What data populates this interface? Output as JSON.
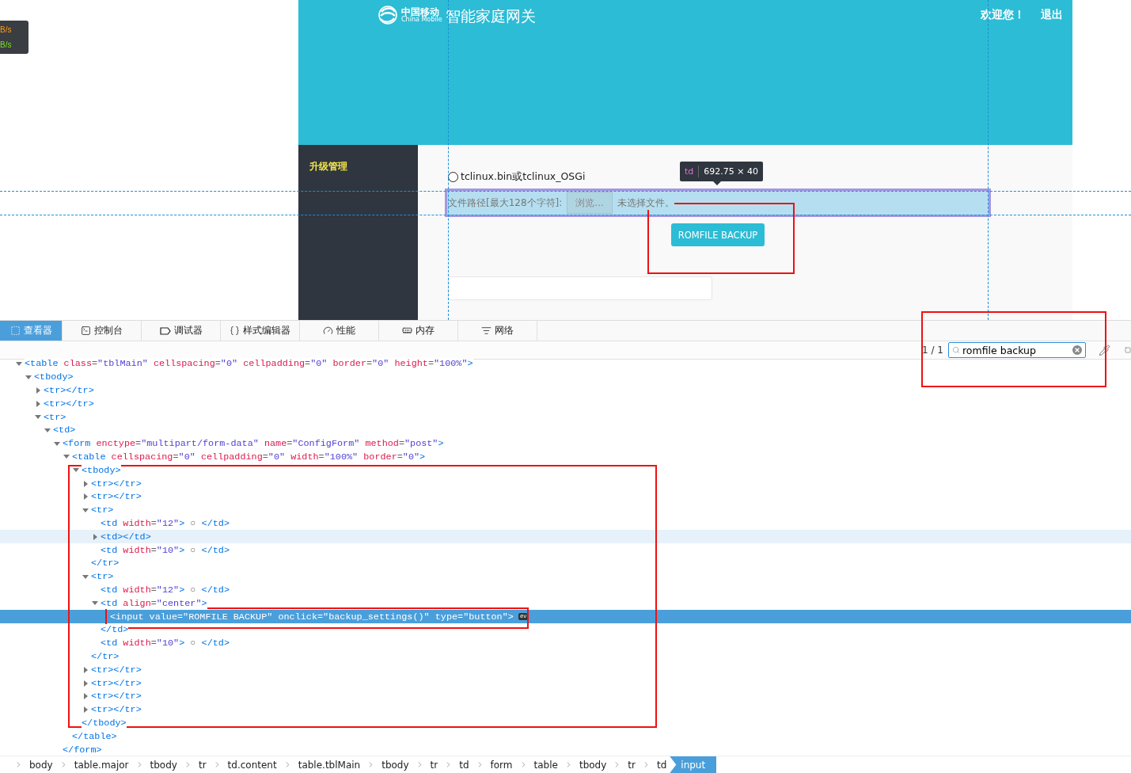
{
  "speed_widget": {
    "lines": [
      {
        "text": "B/s",
        "color": "#ff9c1a"
      },
      {
        "text": "B/s",
        "color": "#7ae01e"
      }
    ]
  },
  "header": {
    "logo_cn": "中国移动",
    "logo_en": "China Mobile",
    "title": "智能家庭网关",
    "links": [
      "欢迎您！",
      "退出"
    ]
  },
  "sidebar": {
    "items": [
      {
        "label": "升级管理",
        "selected": true
      }
    ]
  },
  "content": {
    "radio": {
      "label": "tclinux.bin或tclinux_OSGi",
      "checked": false
    },
    "file_row": {
      "label": "文件路径[最大128个字符]:",
      "browse_button": "浏览...",
      "status": "未选择文件。"
    },
    "backup_button": "ROMFILE BACKUP"
  },
  "inspector_tooltip": {
    "tag": "td",
    "size": "692.75 × 40"
  },
  "devtools": {
    "tabs": [
      {
        "label": "查看器",
        "selected": true
      },
      {
        "label": "控制台",
        "selected": false
      },
      {
        "label": "调试器",
        "selected": false
      },
      {
        "label": "样式编辑器",
        "selected": false
      },
      {
        "label": "性能",
        "selected": false
      },
      {
        "label": "内存",
        "selected": false
      },
      {
        "label": "网络",
        "selected": false
      }
    ],
    "search": {
      "count": "1 / 1",
      "value": "romfile backup"
    },
    "tree": [
      {
        "open": "<table class=\"tblMain\" cellspacing=\"0\" cellpadding=\"0\" border=\"0\" height=\"100%\">",
        "expanded": true,
        "selected": false,
        "hovered": false,
        "children": [
          {
            "open": "<tbody>",
            "expanded": true,
            "selected": false,
            "hovered": false,
            "children": [
              {
                "open": "<tr></tr>",
                "expanded": false,
                "selected": false,
                "hovered": false
              },
              {
                "open": "<tr></tr>",
                "expanded": false,
                "selected": false,
                "hovered": false
              },
              {
                "open": "<tr>",
                "expanded": true,
                "selected": false,
                "hovered": false,
                "children": [
                  {
                    "open": "<td>",
                    "expanded": true,
                    "selected": false,
                    "hovered": false,
                    "children": [
                      {
                        "open": "<form enctype=\"multipart/form-data\" name=\"ConfigForm\" method=\"post\">",
                        "close": "</form>",
                        "expanded": true,
                        "selected": false,
                        "hovered": false,
                        "children": [
                          {
                            "open": "<table cellspacing=\"0\" cellpadding=\"0\" width=\"100%\" border=\"0\">",
                            "close": "</table>",
                            "expanded": true,
                            "selected": false,
                            "hovered": false,
                            "children": [
                              {
                                "open": "<tbody>",
                                "close": "</tbody>",
                                "expanded": true,
                                "selected": false,
                                "hovered": false,
                                "children": [
                                  {
                                    "open": "<tr></tr>",
                                    "expanded": false,
                                    "selected": false,
                                    "hovered": false
                                  },
                                  {
                                    "open": "<tr></tr>",
                                    "expanded": false,
                                    "selected": false,
                                    "hovered": false
                                  },
                                  {
                                    "open": "<tr>",
                                    "close": "</tr>",
                                    "expanded": true,
                                    "selected": false,
                                    "hovered": false,
                                    "children": [
                                      {
                                        "open": "<td width=\"12\"> ○ </td>",
                                        "selected": false,
                                        "hovered": false
                                      },
                                      {
                                        "open": "<td></td>",
                                        "expanded": false,
                                        "selected": false,
                                        "hovered": true
                                      },
                                      {
                                        "open": "<td width=\"10\"> ○ </td>",
                                        "selected": false,
                                        "hovered": false
                                      }
                                    ]
                                  },
                                  {
                                    "open": "<tr>",
                                    "close": "</tr>",
                                    "expanded": true,
                                    "selected": false,
                                    "hovered": false,
                                    "children": [
                                      {
                                        "open": "<td width=\"12\"> ○ </td>",
                                        "selected": false,
                                        "hovered": false
                                      },
                                      {
                                        "open": "<td align=\"center\">",
                                        "close": "</td>",
                                        "expanded": true,
                                        "selected": false,
                                        "hovered": false,
                                        "children": [
                                          {
                                            "open": "<input value=\"ROMFILE BACKUP\" onclick=\"backup_settings()\" type=\"button\">",
                                            "badge": "ev",
                                            "selected": true,
                                            "hovered": false
                                          }
                                        ]
                                      },
                                      {
                                        "open": "<td width=\"10\"> ○ </td>",
                                        "selected": false,
                                        "hovered": false
                                      }
                                    ]
                                  },
                                  {
                                    "open": "<tr></tr>",
                                    "expanded": false,
                                    "selected": false,
                                    "hovered": false
                                  },
                                  {
                                    "open": "<tr></tr>",
                                    "expanded": false,
                                    "selected": false,
                                    "hovered": false
                                  },
                                  {
                                    "open": "<tr></tr>",
                                    "expanded": false,
                                    "selected": false,
                                    "hovered": false
                                  },
                                  {
                                    "open": "<tr></tr>",
                                    "expanded": false,
                                    "selected": false,
                                    "hovered": false
                                  }
                                ]
                              }
                            ]
                          }
                        ]
                      }
                    ]
                  }
                ]
              }
            ]
          }
        ]
      }
    ],
    "breadcrumbs": [
      {
        "label": "body",
        "selected": false
      },
      {
        "label": "table.major",
        "selected": false
      },
      {
        "label": "tbody",
        "selected": false
      },
      {
        "label": "tr",
        "selected": false
      },
      {
        "label": "td.content",
        "selected": false
      },
      {
        "label": "table.tblMain",
        "selected": false
      },
      {
        "label": "tbody",
        "selected": false
      },
      {
        "label": "tr",
        "selected": false
      },
      {
        "label": "td",
        "selected": false
      },
      {
        "label": "form",
        "selected": false
      },
      {
        "label": "table",
        "selected": false
      },
      {
        "label": "tbody",
        "selected": false
      },
      {
        "label": "tr",
        "selected": false
      },
      {
        "label": "td",
        "selected": false
      },
      {
        "label": "input",
        "selected": true
      }
    ]
  }
}
